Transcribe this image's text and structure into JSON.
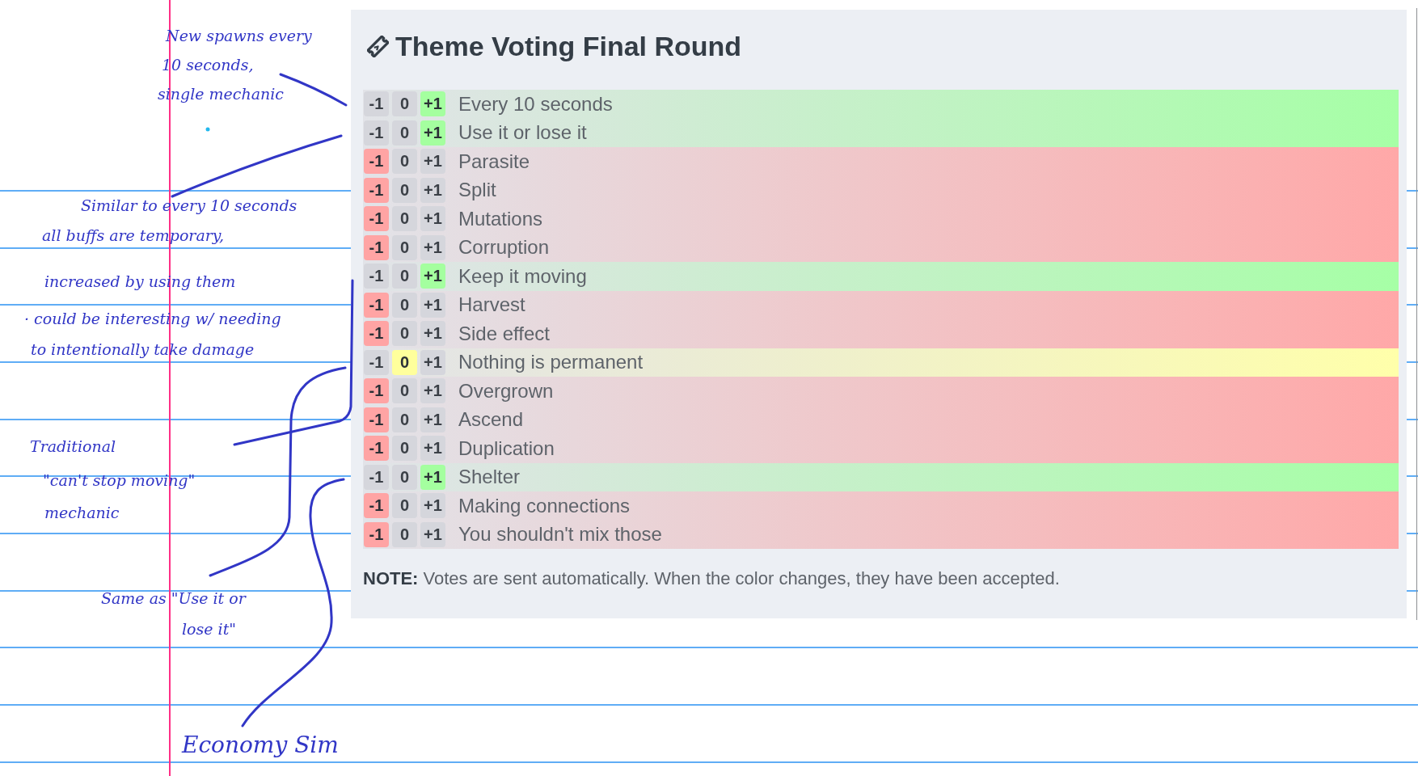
{
  "handwritten_notes": [
    {
      "lines": [
        "New spawns every",
        "10 seconds,",
        "single mechanic"
      ]
    },
    {
      "lines": [
        "Similar to every 10 seconds",
        "all buffs are temporary,",
        "increased by using them",
        "· could be interesting w/ needing",
        "to intentionally take damage"
      ]
    },
    {
      "lines": [
        "Traditional",
        "\"can't stop moving\"",
        "mechanic"
      ]
    },
    {
      "lines": [
        "Same as \"Use it or",
        "lose it\""
      ]
    },
    {
      "lines": [
        "Economy Sim"
      ]
    }
  ],
  "panel": {
    "title": "Theme Voting Final Round",
    "rows": [
      {
        "label": "Every 10 seconds",
        "votes": [
          {
            "label": "-1",
            "selected": false
          },
          {
            "label": "0",
            "selected": false
          },
          {
            "label": "+1",
            "selected": true
          }
        ]
      },
      {
        "label": "Use it or lose it",
        "votes": [
          {
            "label": "-1",
            "selected": false
          },
          {
            "label": "0",
            "selected": false
          },
          {
            "label": "+1",
            "selected": true
          }
        ]
      },
      {
        "label": "Parasite",
        "votes": [
          {
            "label": "-1",
            "selected": true
          },
          {
            "label": "0",
            "selected": false
          },
          {
            "label": "+1",
            "selected": false
          }
        ]
      },
      {
        "label": "Split",
        "votes": [
          {
            "label": "-1",
            "selected": true
          },
          {
            "label": "0",
            "selected": false
          },
          {
            "label": "+1",
            "selected": false
          }
        ]
      },
      {
        "label": "Mutations",
        "votes": [
          {
            "label": "-1",
            "selected": true
          },
          {
            "label": "0",
            "selected": false
          },
          {
            "label": "+1",
            "selected": false
          }
        ]
      },
      {
        "label": "Corruption",
        "votes": [
          {
            "label": "-1",
            "selected": true
          },
          {
            "label": "0",
            "selected": false
          },
          {
            "label": "+1",
            "selected": false
          }
        ]
      },
      {
        "label": "Keep it moving",
        "votes": [
          {
            "label": "-1",
            "selected": false
          },
          {
            "label": "0",
            "selected": false
          },
          {
            "label": "+1",
            "selected": true
          }
        ]
      },
      {
        "label": "Harvest",
        "votes": [
          {
            "label": "-1",
            "selected": true
          },
          {
            "label": "0",
            "selected": false
          },
          {
            "label": "+1",
            "selected": false
          }
        ]
      },
      {
        "label": "Side effect",
        "votes": [
          {
            "label": "-1",
            "selected": true
          },
          {
            "label": "0",
            "selected": false
          },
          {
            "label": "+1",
            "selected": false
          }
        ]
      },
      {
        "label": "Nothing is permanent",
        "votes": [
          {
            "label": "-1",
            "selected": false
          },
          {
            "label": "0",
            "selected": true
          },
          {
            "label": "+1",
            "selected": false
          }
        ]
      },
      {
        "label": "Overgrown",
        "votes": [
          {
            "label": "-1",
            "selected": true
          },
          {
            "label": "0",
            "selected": false
          },
          {
            "label": "+1",
            "selected": false
          }
        ]
      },
      {
        "label": "Ascend",
        "votes": [
          {
            "label": "-1",
            "selected": true
          },
          {
            "label": "0",
            "selected": false
          },
          {
            "label": "+1",
            "selected": false
          }
        ]
      },
      {
        "label": "Duplication",
        "votes": [
          {
            "label": "-1",
            "selected": true
          },
          {
            "label": "0",
            "selected": false
          },
          {
            "label": "+1",
            "selected": false
          }
        ]
      },
      {
        "label": "Shelter",
        "votes": [
          {
            "label": "-1",
            "selected": false
          },
          {
            "label": "0",
            "selected": false
          },
          {
            "label": "+1",
            "selected": true
          }
        ]
      },
      {
        "label": "Making connections",
        "votes": [
          {
            "label": "-1",
            "selected": true
          },
          {
            "label": "0",
            "selected": false
          },
          {
            "label": "+1",
            "selected": false
          }
        ]
      },
      {
        "label": "You shouldn't mix those",
        "votes": [
          {
            "label": "-1",
            "selected": true
          },
          {
            "label": "0",
            "selected": false
          },
          {
            "label": "+1",
            "selected": false
          }
        ]
      }
    ],
    "note": "**NOTE:** Votes are sent automatically. When the color changes, they have been accepted."
  }
}
